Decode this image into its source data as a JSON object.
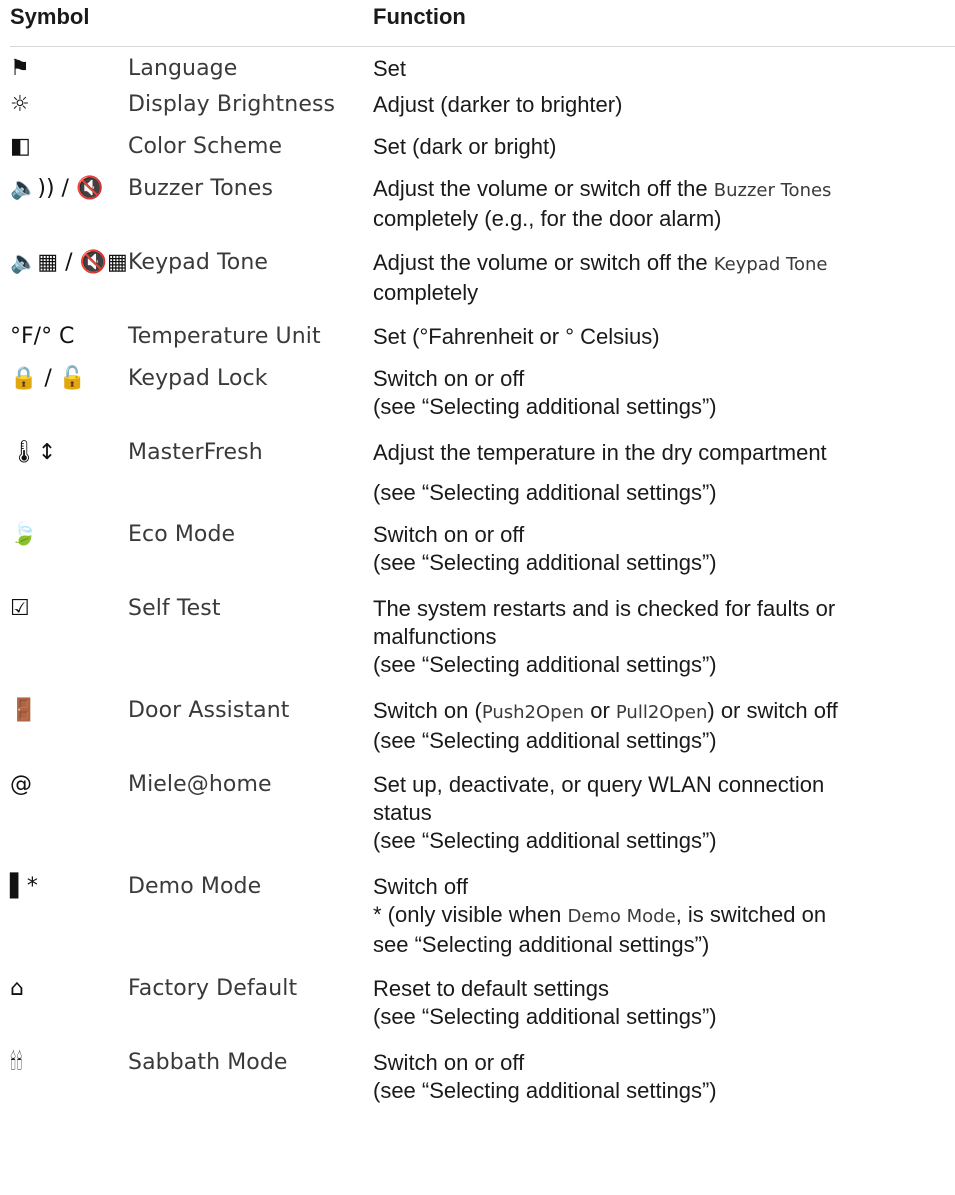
{
  "header": {
    "symbol": "Symbol",
    "function": "Function"
  },
  "rows": [
    {
      "icon": "flag-icon",
      "symbol": "⚑",
      "name": "Language",
      "function": [
        "Set"
      ]
    },
    {
      "icon": "sun-icon",
      "symbol": "☼",
      "name": "Display Brightness",
      "function": [
        "Adjust (darker to brighter)"
      ]
    },
    {
      "icon": "half-square-icon",
      "symbol": "◧",
      "name": "Color Scheme",
      "function": [
        "Set (dark or bright)"
      ]
    },
    {
      "icon": "speaker-icon",
      "symbol": "🔈)) / 🔇",
      "name": "Buzzer Tones",
      "function_pre": "Adjust the volume or switch off the ",
      "function_term": "Buzzer Tones",
      "function_line2": "completely (e.g., for the door alarm)"
    },
    {
      "icon": "keypad-speaker-icon",
      "symbol": "🔈▦ / 🔇▦",
      "name": "Keypad Tone",
      "function_pre": "Adjust the volume or switch off the ",
      "function_term": "Keypad Tone",
      "function_line2": "completely"
    },
    {
      "icon": "temperature-unit-icon",
      "symbol": "°F/° C",
      "name": "Temperature Unit",
      "function": [
        "Set (°Fahrenheit or ° Celsius)"
      ]
    },
    {
      "icon": "lock-icon",
      "symbol": "🔒 / 🔓",
      "name": "Keypad Lock",
      "function": [
        "Switch on or off",
        "(see “Selecting additional settings”)"
      ]
    },
    {
      "icon": "thermometer-icon",
      "symbol": "🌡↕",
      "name": "MasterFresh",
      "function": [
        "Adjust the temperature in the dry compartment"
      ],
      "function_gap": "(see “Selecting additional settings”)"
    },
    {
      "icon": "eco-leaf-icon",
      "symbol": "🍃",
      "name": "Eco Mode",
      "function": [
        "Switch on or off",
        "(see “Selecting additional settings”)"
      ]
    },
    {
      "icon": "checkbox-icon",
      "symbol": "☑",
      "name": "Self Test",
      "function": [
        "The system restarts and is checked for faults or",
        "malfunctions",
        "(see “Selecting additional settings”)"
      ]
    },
    {
      "icon": "door-icon",
      "symbol": "🚪",
      "name": "Door Assistant",
      "door_a": "Switch on (",
      "door_push": "Push2Open",
      "door_or": " or ",
      "door_pull": "Pull2Open",
      "door_b": ") or switch off",
      "function_line2": "(see “Selecting additional settings”)"
    },
    {
      "icon": "at-icon",
      "symbol": "@",
      "name": "Miele@home",
      "function": [
        "Set up, deactivate, or query WLAN connection",
        "status",
        "(see “Selecting additional settings”)"
      ]
    },
    {
      "icon": "demo-icon",
      "symbol": "▌*",
      "name": "Demo Mode",
      "function_line1": "Switch off",
      "demo_pre": "* (only visible when ",
      "demo_term": "Demo Mode",
      "demo_post": ", is switched on",
      "function_line3": "see “Selecting additional settings”)"
    },
    {
      "icon": "factory-icon",
      "symbol": "⌂",
      "name": "Factory Default",
      "function": [
        "Reset to default settings",
        "(see “Selecting additional settings”)"
      ]
    },
    {
      "icon": "sabbath-candles-icon",
      "symbol": "🕯🕯",
      "name": "Sabbath Mode",
      "function": [
        "Switch on or off",
        "(see “Selecting additional settings”)"
      ]
    }
  ]
}
